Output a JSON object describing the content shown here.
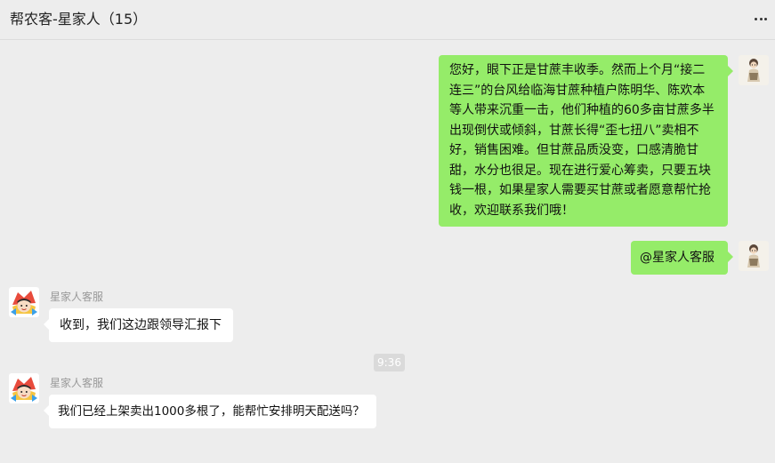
{
  "header": {
    "title": "帮农客-星家人（15）",
    "more_icon": "more-horizontal-icon"
  },
  "messages": [
    {
      "sender": "me",
      "lines": [
        "您好，眼下正是甘蔗丰收季。然而上个月“接二",
        "连三”的台风给临海甘蔗种植户陈明华、陈欢本",
        "等人带来沉重一击，他们种植的60多亩甘蔗多半",
        "出现倒伏或倾斜，甘蔗长得“歪七扭八”卖相不",
        "好，销售困难。但甘蔗品质没变，口感清脆甘",
        "甜，水分也很足。现在进行爱心筹卖，只要五块",
        "钱一根，如果星家人需要买甘蔗或者愿意帮忙抢",
        "收，欢迎联系我们哦！"
      ]
    },
    {
      "sender": "me",
      "text": "@星家人客服"
    },
    {
      "sender": "other",
      "name": "星家人客服",
      "text": "收到，我们这边跟领导汇报下"
    },
    {
      "sender": "other",
      "name": "星家人客服",
      "text": "我们已经上架卖出1000多根了，能帮忙安排明天配送吗？"
    }
  ],
  "timestamp": "9:36",
  "colors": {
    "background": "#ededed",
    "my_bubble": "#95ec69",
    "other_bubble": "#ffffff"
  }
}
